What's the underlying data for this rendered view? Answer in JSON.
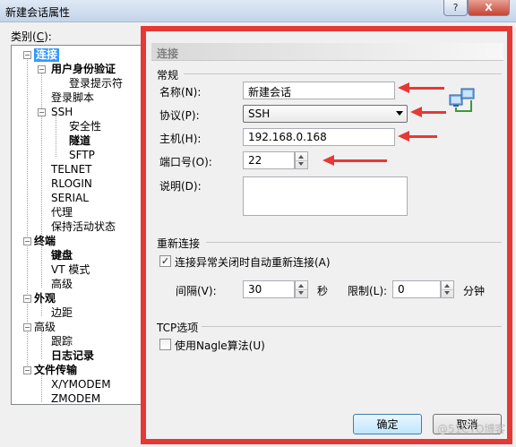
{
  "window": {
    "title": "新建会话属性",
    "help_glyph": "?",
    "close_glyph": "X"
  },
  "category": {
    "label_pre": "类别(",
    "label_key": "C",
    "label_post": "):"
  },
  "tree": {
    "items": [
      {
        "label": "连接",
        "bold": true,
        "selected": true
      },
      {
        "label": "用户身份验证",
        "bold": true
      },
      {
        "label": "登录提示符"
      },
      {
        "label": "登录脚本"
      },
      {
        "label": "SSH"
      },
      {
        "label": "安全性"
      },
      {
        "label": "隧道",
        "bold": true
      },
      {
        "label": "SFTP"
      },
      {
        "label": "TELNET"
      },
      {
        "label": "RLOGIN"
      },
      {
        "label": "SERIAL"
      },
      {
        "label": "代理"
      },
      {
        "label": "保持活动状态"
      },
      {
        "label": "终端",
        "bold": true
      },
      {
        "label": "键盘",
        "bold": true
      },
      {
        "label": "VT 模式"
      },
      {
        "label": "高级"
      },
      {
        "label": "外观",
        "bold": true
      },
      {
        "label": "边距"
      },
      {
        "label": "高级"
      },
      {
        "label": "跟踪"
      },
      {
        "label": "日志记录",
        "bold": true
      },
      {
        "label": "文件传输",
        "bold": true
      },
      {
        "label": "X/YMODEM"
      },
      {
        "label": "ZMODEM"
      }
    ],
    "expander_glyph": "−"
  },
  "panel": {
    "header": "连接",
    "general": {
      "title": "常规",
      "name": {
        "label": "名称(N):",
        "value": "新建会话"
      },
      "protocol": {
        "label": "协议(P):",
        "value": "SSH"
      },
      "host": {
        "label": "主机(H):",
        "value": "192.168.0.168"
      },
      "port": {
        "label": "端口号(O):",
        "value": "22"
      },
      "description": {
        "label": "说明(D):",
        "value": ""
      }
    },
    "reconnect": {
      "title": "重新连接",
      "auto_reconnect": {
        "label": "连接异常关闭时自动重新连接(A)",
        "checked": true
      },
      "interval": {
        "label": "间隔(V):",
        "value": "30",
        "unit": "秒"
      },
      "limit": {
        "label": "限制(L):",
        "value": "0",
        "unit": "分钟"
      }
    },
    "tcp": {
      "title": "TCP选项",
      "nagle": {
        "label": "使用Nagle算法(U)",
        "checked": false
      }
    }
  },
  "buttons": {
    "ok": "确定",
    "cancel": "取消"
  },
  "watermark": "@51CTO博客",
  "colors": {
    "annotation_red": "#e53935",
    "selection_blue": "#3399ff"
  }
}
